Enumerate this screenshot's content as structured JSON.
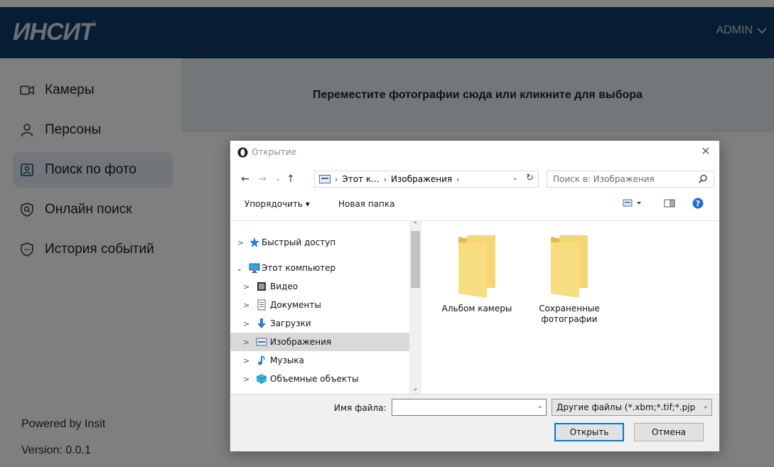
{
  "app": {
    "logo_text": "ИНСИТ",
    "user_menu": "ADMIN",
    "sidebar": {
      "items": [
        {
          "label": "Камеры",
          "icon": "camera-icon"
        },
        {
          "label": "Персоны",
          "icon": "person-icon"
        },
        {
          "label": "Поиск по фото",
          "icon": "photo-search-icon",
          "active": true
        },
        {
          "label": "Онлайн поиск",
          "icon": "shield-search-icon"
        },
        {
          "label": "История событий",
          "icon": "shield-history-icon"
        }
      ],
      "powered_by": "Powered by  Insit",
      "version": "Version: 0.0.1"
    },
    "dropzone_text": "Переместите фотографии сюда или кликните для выбора",
    "colors": {
      "header_bg": "#0d3a66",
      "active_item_bg": "#e4ebf3",
      "dropzone_bg": "#e8eef5"
    }
  },
  "dialog": {
    "title": "Открытие",
    "breadcrumb": [
      "Этот к...",
      "Изображения"
    ],
    "search_placeholder": "Поиск в: Изображения",
    "toolbar": {
      "organize": "Упорядочить ▾",
      "new_folder": "Новая папка"
    },
    "tree": [
      {
        "label": "Быстрый доступ",
        "icon": "star-icon",
        "chevron": ">"
      },
      {
        "label": "Этот компьютер",
        "icon": "computer-icon",
        "chevron": "⌄",
        "expanded": true
      },
      {
        "label": "Видео",
        "icon": "video-folder-icon",
        "chevron": ">"
      },
      {
        "label": "Документы",
        "icon": "documents-folder-icon",
        "chevron": ">"
      },
      {
        "label": "Загрузки",
        "icon": "downloads-folder-icon",
        "chevron": ">"
      },
      {
        "label": "Изображения",
        "icon": "pictures-folder-icon",
        "chevron": ">",
        "selected": true
      },
      {
        "label": "Музыка",
        "icon": "music-folder-icon",
        "chevron": ">"
      },
      {
        "label": "Объемные объекты",
        "icon": "3d-objects-folder-icon",
        "chevron": ">"
      }
    ],
    "files": [
      {
        "label": "Альбом камеры",
        "icon": "folder-icon"
      },
      {
        "label": "Сохраненные фотографии",
        "icon": "folder-icon"
      }
    ],
    "filename_label": "Имя файла:",
    "filename_value": "",
    "filetype": "Другие файлы (*.xbm;*.tif;*.pjp",
    "open_button": "Открыть",
    "cancel_button": "Отмена"
  }
}
